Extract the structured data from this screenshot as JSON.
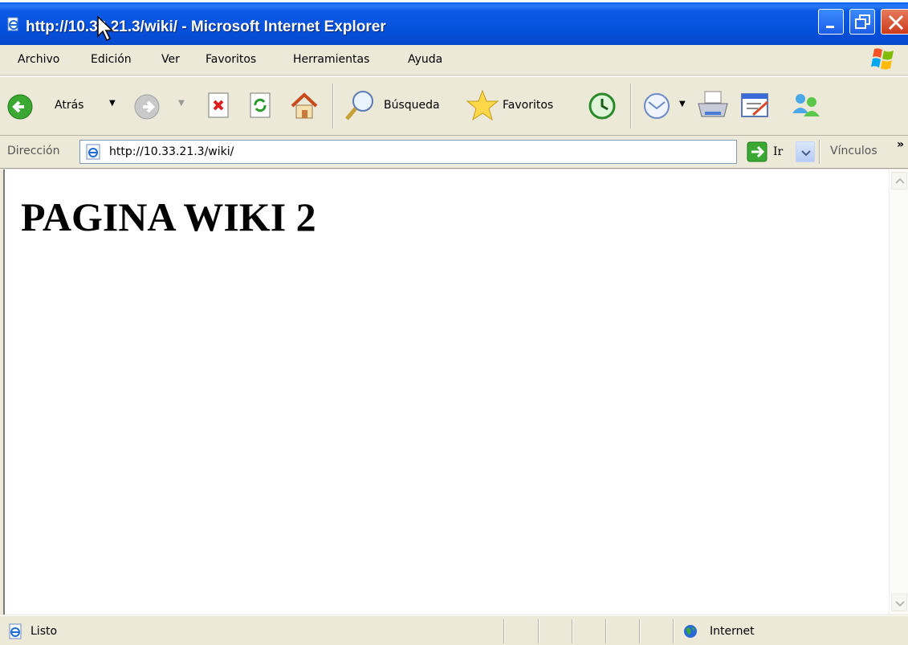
{
  "window": {
    "title": "http://10.33.21.3/wiki/ - Microsoft Internet Explorer",
    "title_color": "#0552dd"
  },
  "menu": {
    "items": [
      "Archivo",
      "Edición",
      "Ver",
      "Favoritos",
      "Herramientas",
      "Ayuda"
    ]
  },
  "toolbar": {
    "back_label": "Atrás",
    "search_label": "Búsqueda",
    "favorites_label": "Favoritos"
  },
  "address": {
    "label": "Dirección",
    "url": "http://10.33.21.3/wiki/",
    "go_label": "Ir",
    "links_label": "Vínculos",
    "links_chevron": "»"
  },
  "page": {
    "heading": "PAGINA WIKI 2"
  },
  "status": {
    "text": "Listo",
    "zone": "Internet"
  }
}
